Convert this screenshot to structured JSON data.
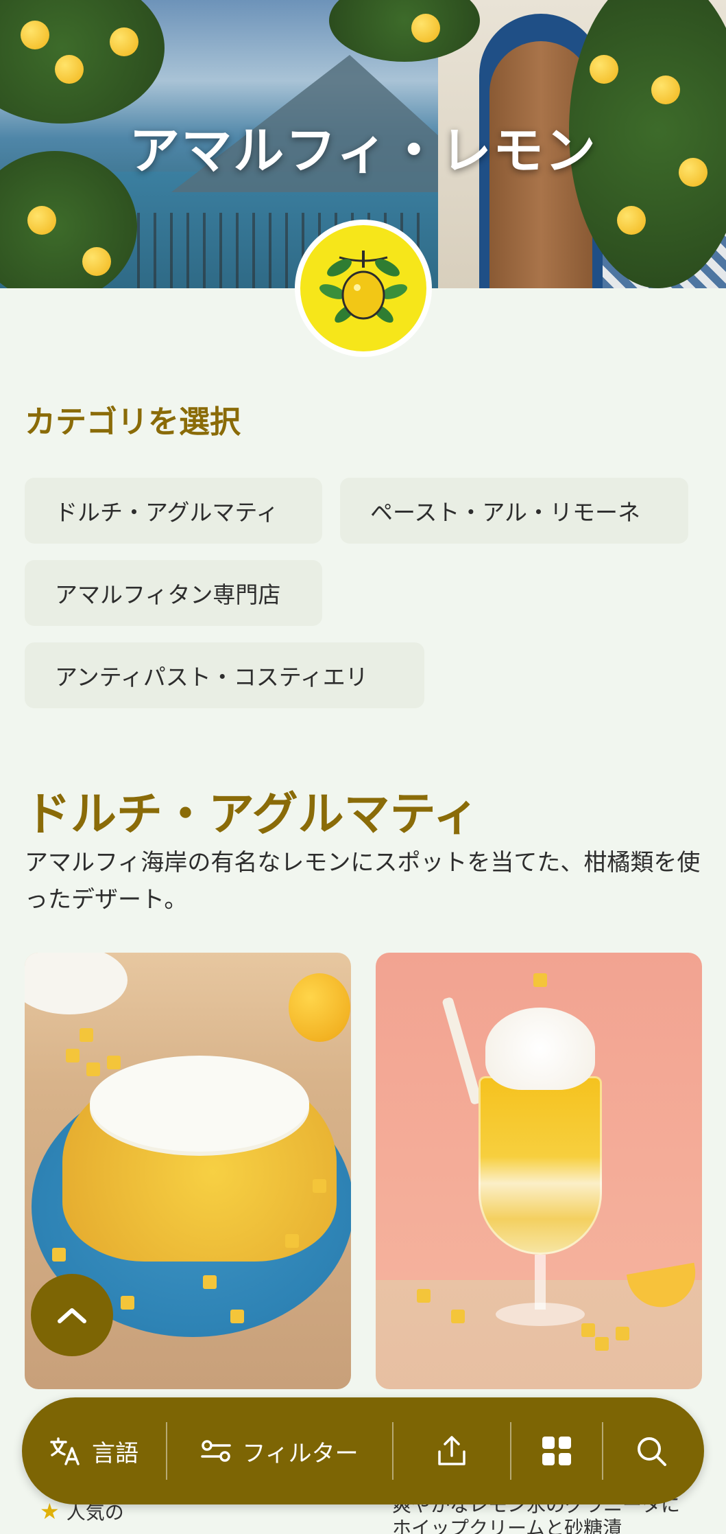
{
  "hero": {
    "title": "アマルフィ・レモン"
  },
  "categories_section": {
    "heading": "カテゴリを選択",
    "chips": [
      "ドルチ・アグルマティ",
      "ペースト・アル・リモーネ",
      "アマルフィタン専門店",
      "アンティパスト・コスティエリ"
    ]
  },
  "category": {
    "title": "ドルチ・アグルマティ",
    "description": "アマルフィ海岸の有名なレモンにスポットを当てた、柑橘類を使ったデザート。"
  },
  "items": [
    {
      "image": "lemon-bundt-cake",
      "tag": "人気の"
    },
    {
      "image": "lemon-granita-float",
      "desc": "爽やかなレモン氷のグラニータにホイップクリームと砂糖漬"
    }
  ],
  "bottom_nav": {
    "language_label": "言語",
    "filter_label": "フィルター",
    "icons": [
      "translate-icon",
      "filter-icon",
      "share-icon",
      "grid-icon",
      "search-icon"
    ]
  },
  "colors": {
    "accent": "#7d6504",
    "heading": "#8a6b08",
    "background": "#f1f6ef",
    "chip": "#e9eee4"
  }
}
